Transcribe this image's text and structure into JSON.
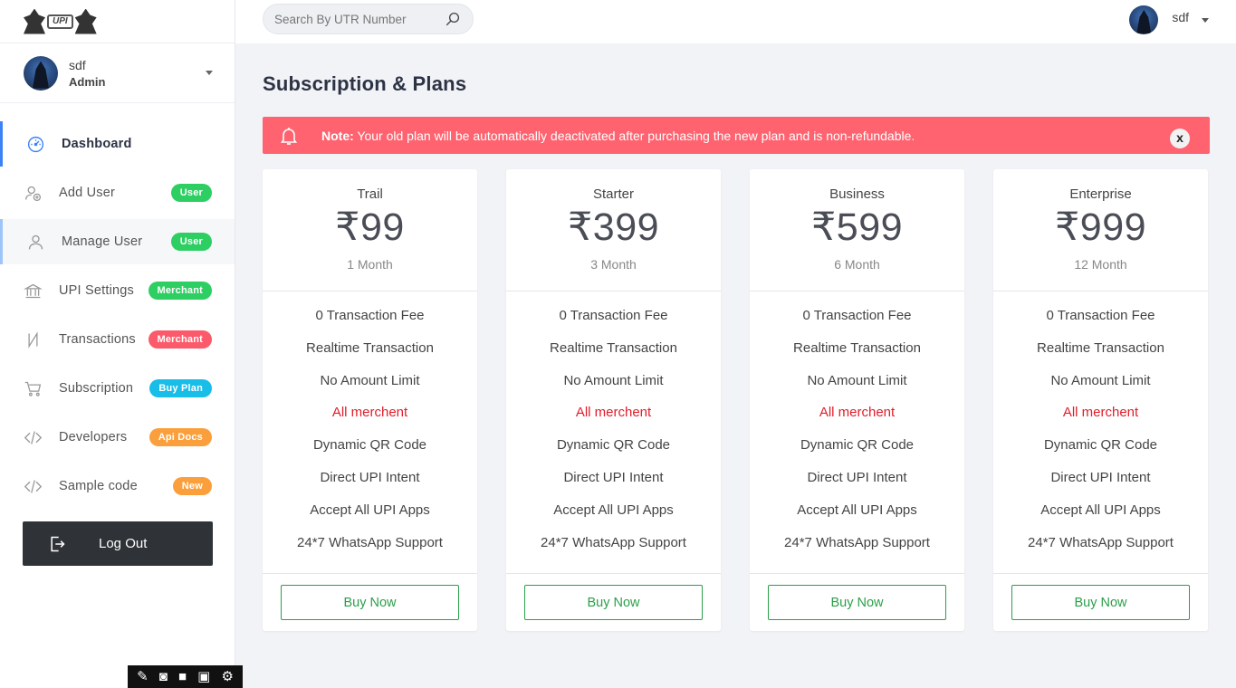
{
  "brand": {
    "logo_text": "UPI"
  },
  "sidebar": {
    "user": {
      "name": "sdf",
      "role": "Admin"
    },
    "items": [
      {
        "label": "Dashboard",
        "icon": "dashboard-icon",
        "badge": "",
        "badge_color": ""
      },
      {
        "label": "Add User",
        "icon": "add-user-icon",
        "badge": "User",
        "badge_color": "#2dce62"
      },
      {
        "label": "Manage User",
        "icon": "user-icon",
        "badge": "User",
        "badge_color": "#2dce62"
      },
      {
        "label": "UPI Settings",
        "icon": "bank-icon",
        "badge": "Merchant",
        "badge_color": "#2dce62"
      },
      {
        "label": "Transactions",
        "icon": "rupee-icon",
        "badge": "Merchant",
        "badge_color": "#fb5a6a"
      },
      {
        "label": "Subscription",
        "icon": "cart-icon",
        "badge": "Buy Plan",
        "badge_color": "#18bde8"
      },
      {
        "label": "Developers",
        "icon": "code-icon",
        "badge": "Api Docs",
        "badge_color": "#fb9f3c"
      },
      {
        "label": "Sample code",
        "icon": "code-icon",
        "badge": "New",
        "badge_color": "#fb9f3c"
      }
    ],
    "logout_label": "Log Out"
  },
  "header": {
    "search_placeholder": "Search By UTR Number",
    "user_name": "sdf"
  },
  "page": {
    "title": "Subscription & Plans",
    "alert": {
      "strong": "Note:",
      "text": " Your old plan will be automatically deactivated after purchasing the new plan and is non-refundable.",
      "close": "x",
      "color": "#fe636f"
    }
  },
  "plans": [
    {
      "name": "Trail",
      "price": "₹99",
      "duration": "1 Month",
      "features": [
        "0 Transaction Fee",
        "Realtime Transaction",
        "No Amount Limit",
        "All merchent",
        "Dynamic QR Code",
        "Direct UPI Intent",
        "Accept All UPI Apps",
        "24*7 WhatsApp Support"
      ],
      "button": "Buy Now"
    },
    {
      "name": "Starter",
      "price": "₹399",
      "duration": "3 Month",
      "features": [
        "0 Transaction Fee",
        "Realtime Transaction",
        "No Amount Limit",
        "All merchent",
        "Dynamic QR Code",
        "Direct UPI Intent",
        "Accept All UPI Apps",
        "24*7 WhatsApp Support"
      ],
      "button": "Buy Now"
    },
    {
      "name": "Business",
      "price": "₹599",
      "duration": "6 Month",
      "features": [
        "0 Transaction Fee",
        "Realtime Transaction",
        "No Amount Limit",
        "All merchent",
        "Dynamic QR Code",
        "Direct UPI Intent",
        "Accept All UPI Apps",
        "24*7 WhatsApp Support"
      ],
      "button": "Buy Now"
    },
    {
      "name": "Enterprise",
      "price": "₹999",
      "duration": "12 Month",
      "features": [
        "0 Transaction Fee",
        "Realtime Transaction",
        "No Amount Limit",
        "All merchent",
        "Dynamic QR Code",
        "Direct UPI Intent",
        "Accept All UPI Apps",
        "24*7 WhatsApp Support"
      ],
      "button": "Buy Now"
    }
  ],
  "highlight_feature_index": 3,
  "colors": {
    "accent": "#3b82f6",
    "buy_button": "#2aa04a",
    "highlight_feature": "#e11d2a"
  }
}
